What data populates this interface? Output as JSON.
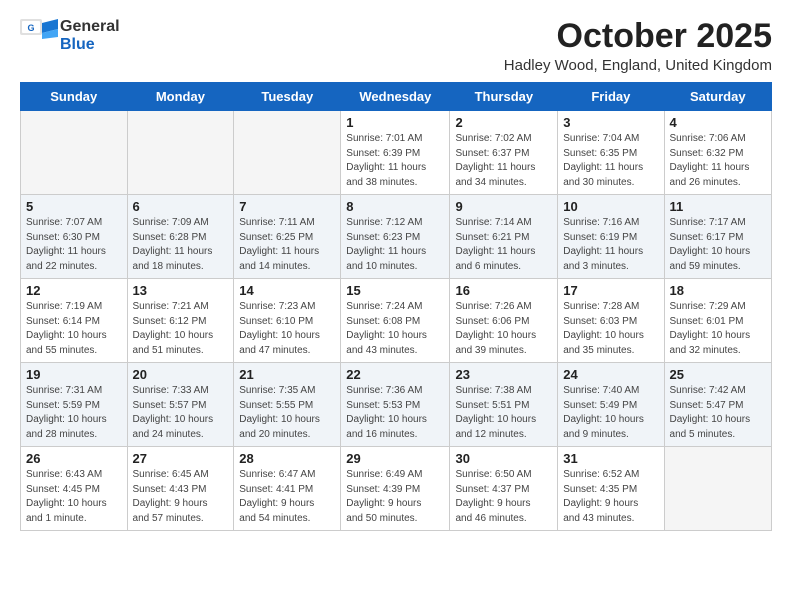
{
  "logo": {
    "general": "General",
    "blue": "Blue"
  },
  "title": "October 2025",
  "location": "Hadley Wood, England, United Kingdom",
  "weekdays": [
    "Sunday",
    "Monday",
    "Tuesday",
    "Wednesday",
    "Thursday",
    "Friday",
    "Saturday"
  ],
  "weeks": [
    [
      {
        "day": "",
        "info": ""
      },
      {
        "day": "",
        "info": ""
      },
      {
        "day": "",
        "info": ""
      },
      {
        "day": "1",
        "info": "Sunrise: 7:01 AM\nSunset: 6:39 PM\nDaylight: 11 hours\nand 38 minutes."
      },
      {
        "day": "2",
        "info": "Sunrise: 7:02 AM\nSunset: 6:37 PM\nDaylight: 11 hours\nand 34 minutes."
      },
      {
        "day": "3",
        "info": "Sunrise: 7:04 AM\nSunset: 6:35 PM\nDaylight: 11 hours\nand 30 minutes."
      },
      {
        "day": "4",
        "info": "Sunrise: 7:06 AM\nSunset: 6:32 PM\nDaylight: 11 hours\nand 26 minutes."
      }
    ],
    [
      {
        "day": "5",
        "info": "Sunrise: 7:07 AM\nSunset: 6:30 PM\nDaylight: 11 hours\nand 22 minutes."
      },
      {
        "day": "6",
        "info": "Sunrise: 7:09 AM\nSunset: 6:28 PM\nDaylight: 11 hours\nand 18 minutes."
      },
      {
        "day": "7",
        "info": "Sunrise: 7:11 AM\nSunset: 6:25 PM\nDaylight: 11 hours\nand 14 minutes."
      },
      {
        "day": "8",
        "info": "Sunrise: 7:12 AM\nSunset: 6:23 PM\nDaylight: 11 hours\nand 10 minutes."
      },
      {
        "day": "9",
        "info": "Sunrise: 7:14 AM\nSunset: 6:21 PM\nDaylight: 11 hours\nand 6 minutes."
      },
      {
        "day": "10",
        "info": "Sunrise: 7:16 AM\nSunset: 6:19 PM\nDaylight: 11 hours\nand 3 minutes."
      },
      {
        "day": "11",
        "info": "Sunrise: 7:17 AM\nSunset: 6:17 PM\nDaylight: 10 hours\nand 59 minutes."
      }
    ],
    [
      {
        "day": "12",
        "info": "Sunrise: 7:19 AM\nSunset: 6:14 PM\nDaylight: 10 hours\nand 55 minutes."
      },
      {
        "day": "13",
        "info": "Sunrise: 7:21 AM\nSunset: 6:12 PM\nDaylight: 10 hours\nand 51 minutes."
      },
      {
        "day": "14",
        "info": "Sunrise: 7:23 AM\nSunset: 6:10 PM\nDaylight: 10 hours\nand 47 minutes."
      },
      {
        "day": "15",
        "info": "Sunrise: 7:24 AM\nSunset: 6:08 PM\nDaylight: 10 hours\nand 43 minutes."
      },
      {
        "day": "16",
        "info": "Sunrise: 7:26 AM\nSunset: 6:06 PM\nDaylight: 10 hours\nand 39 minutes."
      },
      {
        "day": "17",
        "info": "Sunrise: 7:28 AM\nSunset: 6:03 PM\nDaylight: 10 hours\nand 35 minutes."
      },
      {
        "day": "18",
        "info": "Sunrise: 7:29 AM\nSunset: 6:01 PM\nDaylight: 10 hours\nand 32 minutes."
      }
    ],
    [
      {
        "day": "19",
        "info": "Sunrise: 7:31 AM\nSunset: 5:59 PM\nDaylight: 10 hours\nand 28 minutes."
      },
      {
        "day": "20",
        "info": "Sunrise: 7:33 AM\nSunset: 5:57 PM\nDaylight: 10 hours\nand 24 minutes."
      },
      {
        "day": "21",
        "info": "Sunrise: 7:35 AM\nSunset: 5:55 PM\nDaylight: 10 hours\nand 20 minutes."
      },
      {
        "day": "22",
        "info": "Sunrise: 7:36 AM\nSunset: 5:53 PM\nDaylight: 10 hours\nand 16 minutes."
      },
      {
        "day": "23",
        "info": "Sunrise: 7:38 AM\nSunset: 5:51 PM\nDaylight: 10 hours\nand 12 minutes."
      },
      {
        "day": "24",
        "info": "Sunrise: 7:40 AM\nSunset: 5:49 PM\nDaylight: 10 hours\nand 9 minutes."
      },
      {
        "day": "25",
        "info": "Sunrise: 7:42 AM\nSunset: 5:47 PM\nDaylight: 10 hours\nand 5 minutes."
      }
    ],
    [
      {
        "day": "26",
        "info": "Sunrise: 6:43 AM\nSunset: 4:45 PM\nDaylight: 10 hours\nand 1 minute."
      },
      {
        "day": "27",
        "info": "Sunrise: 6:45 AM\nSunset: 4:43 PM\nDaylight: 9 hours\nand 57 minutes."
      },
      {
        "day": "28",
        "info": "Sunrise: 6:47 AM\nSunset: 4:41 PM\nDaylight: 9 hours\nand 54 minutes."
      },
      {
        "day": "29",
        "info": "Sunrise: 6:49 AM\nSunset: 4:39 PM\nDaylight: 9 hours\nand 50 minutes."
      },
      {
        "day": "30",
        "info": "Sunrise: 6:50 AM\nSunset: 4:37 PM\nDaylight: 9 hours\nand 46 minutes."
      },
      {
        "day": "31",
        "info": "Sunrise: 6:52 AM\nSunset: 4:35 PM\nDaylight: 9 hours\nand 43 minutes."
      },
      {
        "day": "",
        "info": ""
      }
    ]
  ]
}
